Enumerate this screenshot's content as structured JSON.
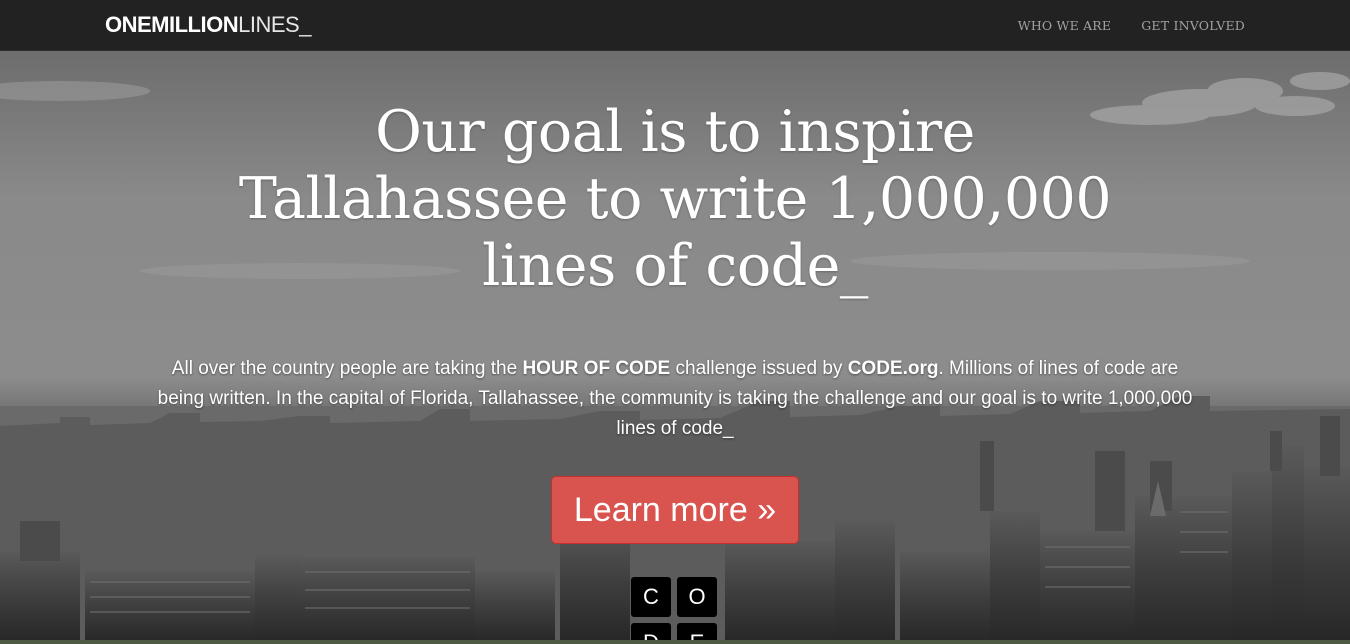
{
  "navbar": {
    "brand_strong": "ONEMILLION",
    "brand_light": "LINES_",
    "links": [
      {
        "label": "WHO WE ARE"
      },
      {
        "label": "GET INVOLVED"
      }
    ]
  },
  "hero": {
    "headline_line1": "Our goal is to inspire",
    "headline_line2": "Tallahassee to write 1,000,000",
    "headline_line3": "lines of code_",
    "lead": {
      "part1": "All over the country people are taking the ",
      "hour_of_code": "HOUR OF CODE",
      "part2": " challenge issued by ",
      "code_org": "CODE.org",
      "part3": ". Millions of lines of code are being written. In the capital of Florida, Tallahassee, the community is taking the challenge and our goal is to write 1,000,000 lines of code_"
    },
    "cta_label": "Learn more »",
    "code_tiles": [
      "C",
      "O",
      "D",
      "E"
    ],
    "accent_color": "#d9534f"
  }
}
